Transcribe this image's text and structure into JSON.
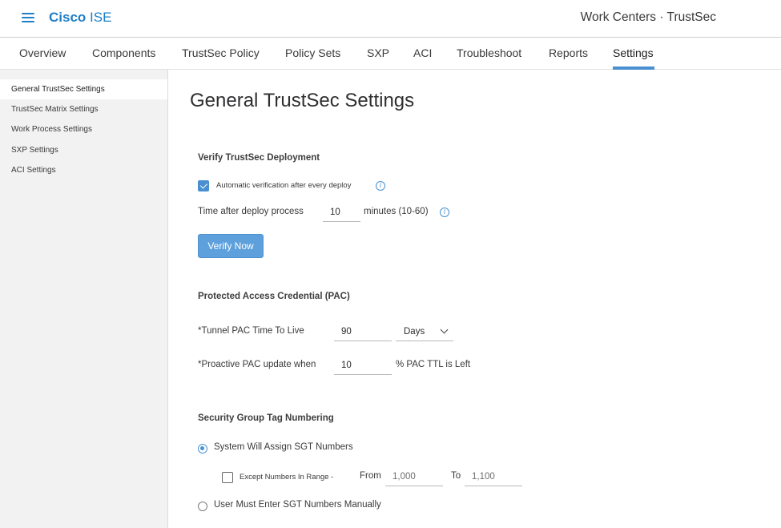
{
  "header": {
    "brand_primary": "Cisco",
    "brand_secondary": "ISE",
    "context_title": "Work Centers · TrustSec"
  },
  "tabs": [
    {
      "label": "Overview"
    },
    {
      "label": "Components"
    },
    {
      "label": "TrustSec Policy"
    },
    {
      "label": "Policy Sets"
    },
    {
      "label": "SXP"
    },
    {
      "label": "ACI"
    },
    {
      "label": "Troubleshoot"
    },
    {
      "label": "Reports"
    },
    {
      "label": "Settings",
      "active": true
    }
  ],
  "sidebar": {
    "items": [
      {
        "label": "General TrustSec Settings",
        "active": true
      },
      {
        "label": "TrustSec Matrix Settings"
      },
      {
        "label": "Work Process Settings"
      },
      {
        "label": "SXP Settings"
      },
      {
        "label": "ACI Settings"
      }
    ]
  },
  "main": {
    "title": "General TrustSec Settings",
    "verify": {
      "section_title": "Verify TrustSec Deployment",
      "auto_verify_label": "Automatic verification after every deploy",
      "auto_verify_checked": true,
      "time_label": "Time after deploy process",
      "time_value": "10",
      "time_unit": "minutes (10-60)",
      "verify_button": "Verify Now"
    },
    "pac": {
      "section_title": "Protected Access Credential (PAC)",
      "ttl_label": "*Tunnel PAC Time To Live",
      "ttl_value": "90",
      "ttl_unit_selected": "Days",
      "proactive_label": "*Proactive PAC update when",
      "proactive_value": "10",
      "proactive_suffix": "% PAC TTL is Left"
    },
    "sgt": {
      "section_title": "Security Group Tag Numbering",
      "system_assign_label": "System Will Assign SGT Numbers",
      "system_assign_selected": true,
      "except_label": "Except Numbers In Range -",
      "except_checked": false,
      "from_label": "From",
      "from_value": "1,000",
      "to_label": "To",
      "to_value": "1,100",
      "manual_label": "User Must Enter SGT Numbers Manually",
      "manual_selected": false
    }
  },
  "colors": {
    "accent": "#4a90d0",
    "brand": "#1f7fc7",
    "sidebar_bg": "#f2f2f3"
  },
  "icons": {
    "menu": "hamburger-menu-icon",
    "info": "info-icon",
    "dropdown": "chevron-down-icon"
  }
}
